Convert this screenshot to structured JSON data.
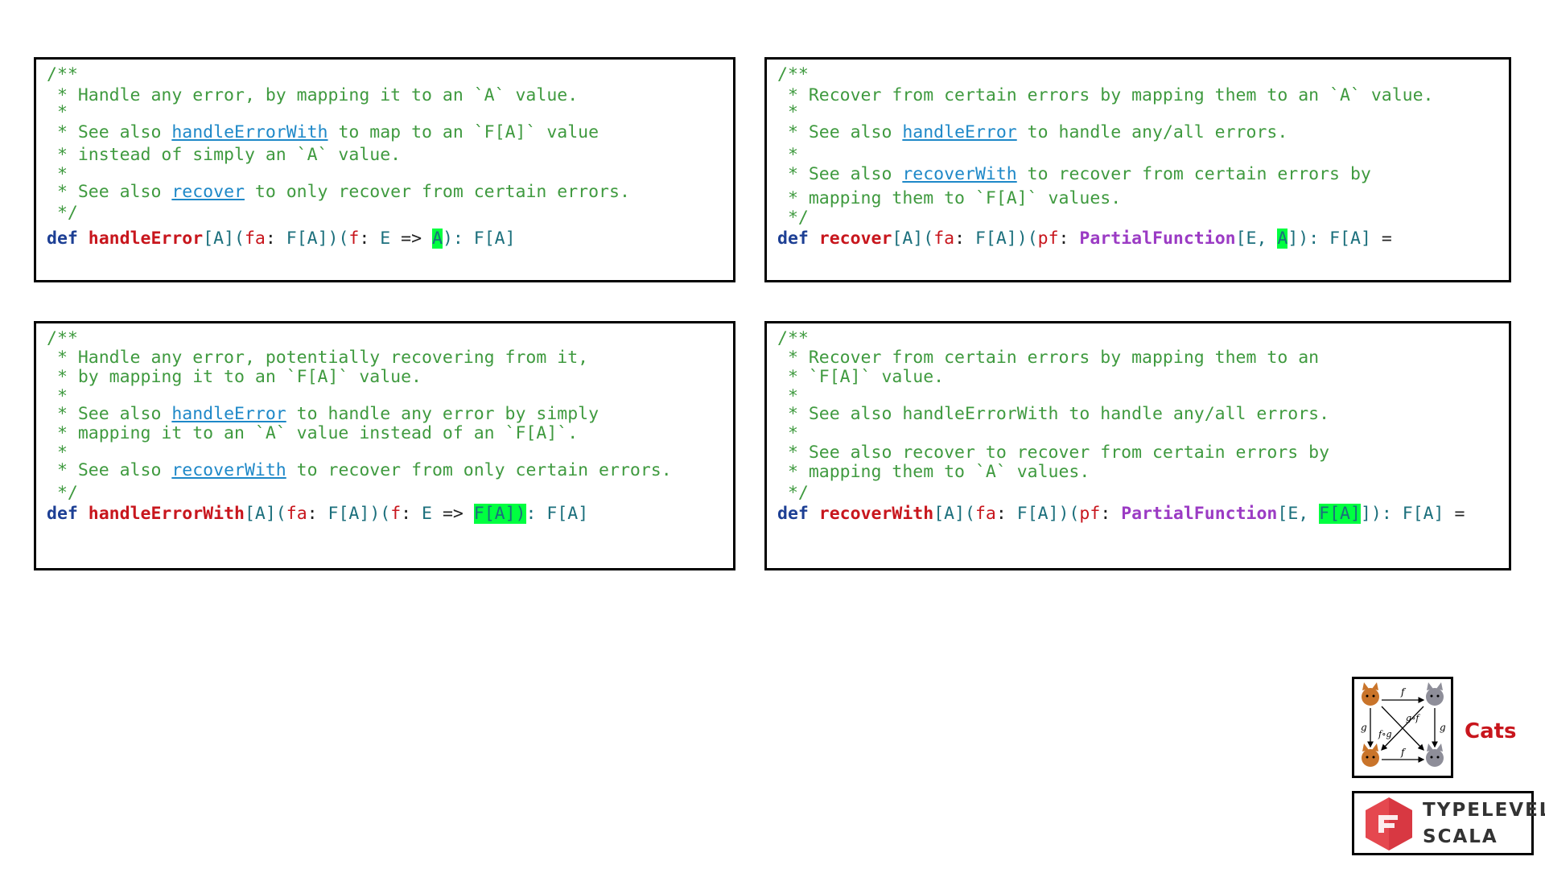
{
  "panel1": {
    "lines": [
      "/**",
      " * Handle any error, by mapping it to an `A` value.",
      " *",
      " * See also ",
      " to map to an `F[A]` value",
      " * instead of simply an `A` value.",
      " *",
      " * See also ",
      " to only recover from certain errors.",
      " */"
    ],
    "link1": "handleErrorWith",
    "link2": "recover",
    "sig": {
      "kw": "def",
      "name": "handleError",
      "tp": "[A](",
      "p1": "fa",
      "colon1": ": ",
      "t1": "F[A]",
      "close1": ")(",
      "p2": "f",
      "colon2": ": ",
      "t2": "E",
      "arrow": " => ",
      "hl": "A",
      "end": "): ",
      "ret": "F[A]"
    }
  },
  "panel2": {
    "lines": [
      "/**",
      " * Recover from certain errors by mapping them to an `A` value.",
      " *",
      " * See also ",
      " to handle any/all errors.",
      " *",
      " * See also ",
      " to recover from certain errors by",
      " * mapping them to `F[A]` values.",
      " */"
    ],
    "link1": "handleError",
    "link2": "recoverWith",
    "sig": {
      "kw": "def",
      "name": "recover",
      "tp": "[A](",
      "p1": "fa",
      "colon1": ": ",
      "t1": "F[A]",
      "close1": ")(",
      "p2": "pf",
      "colon2": ": ",
      "pf": "PartialFunction",
      "t2": "[E, ",
      "hl": "A",
      "end": "]): ",
      "ret": "F[A]",
      "eq": " ="
    }
  },
  "panel3": {
    "lines": [
      "/**",
      " * Handle any error, potentially recovering from it,",
      " * by mapping it to an `F[A]` value.",
      " *",
      " * See also ",
      " to handle any error by simply",
      " * mapping it to an `A` value instead of an `F[A]`.",
      " *",
      " * See also ",
      " to recover from only certain errors.",
      " */"
    ],
    "link1": "handleError",
    "link2": "recoverWith",
    "sig": {
      "kw": "def",
      "name": "handleErrorWith",
      "tp": "[A](",
      "p1": "fa",
      "colon1": ": ",
      "t1": "F[A]",
      "close1": ")(",
      "p2": "f",
      "colon2": ": ",
      "t2": "E",
      "arrow": " => ",
      "hl": "F[A])",
      "end": ": ",
      "ret": "F[A]"
    }
  },
  "panel4": {
    "lines": [
      "/**",
      " * Recover from certain errors by mapping them to an",
      " * `F[A]` value.",
      " *",
      " * See also handleErrorWith to handle any/all errors.",
      " *",
      " * See also recover to recover from certain errors by",
      " * mapping them to `A` values.",
      " */"
    ],
    "sig": {
      "kw": "def",
      "name": "recoverWith",
      "tp": "[A](",
      "p1": "fa",
      "colon1": ": ",
      "t1": "F[A]",
      "close1": ")(",
      "p2": "pf",
      "colon2": ": ",
      "pf": "PartialFunction",
      "t2": "[E, ",
      "hl": "F[A]",
      "end": "]): ",
      "ret": "F[A]",
      "eq": " ="
    }
  },
  "logos": {
    "cats_label": "Cats",
    "cats_diagram": {
      "f": "f",
      "g": "g",
      "fg": "f∘g",
      "gf": "g∘f"
    },
    "typelevel_line1": "TYPELEVEL",
    "typelevel_line2": "SCALA"
  }
}
